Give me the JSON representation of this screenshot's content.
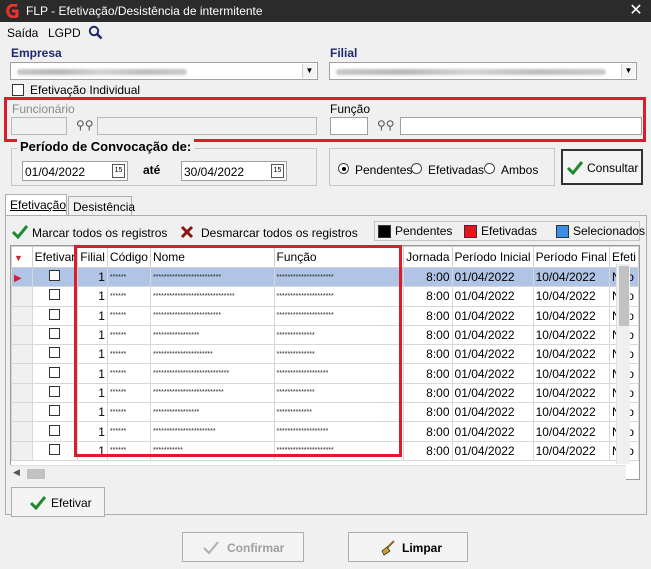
{
  "window": {
    "title": "FLP - Efetivação/Desistência de intermitente",
    "close": "✕"
  },
  "menu": {
    "exit": "Saída",
    "lgpd": "LGPD"
  },
  "empresa": {
    "label": "Empresa"
  },
  "filial": {
    "label": "Filial"
  },
  "individual": {
    "label": "Efetivação Individual"
  },
  "funcionario": {
    "label": "Funcionário"
  },
  "funcao": {
    "label": "Função"
  },
  "period": {
    "label": "Período de Convocação de:",
    "start": "01/04/2022",
    "until": "até",
    "end": "30/04/2022",
    "cal": "15"
  },
  "status": {
    "pending": "Pendentes",
    "effective": "Efetivadas",
    "both": "Ambos"
  },
  "consult": {
    "label": "Consultar"
  },
  "tabs": {
    "efetivacao": "Efetivação",
    "desistencia": "Desistência"
  },
  "actions": {
    "mark_all": "Marcar todos os registros",
    "unmark_all": "Desmarcar todos os registros"
  },
  "legend": [
    {
      "label": "Pendentes",
      "color": "#000000"
    },
    {
      "label": "Efetivadas",
      "color": "#e8141b"
    },
    {
      "label": "Selecionados",
      "color": "#3a8ee6"
    }
  ],
  "grid": {
    "columns": [
      "Efetivar",
      "Filial",
      "Código",
      "Nome",
      "Função",
      "Jornada",
      "Período Inicial",
      "Período Final",
      "Efeti"
    ],
    "rows": [
      {
        "filial": "1",
        "codigo": "******",
        "nome": "*************************",
        "funcao": "*********************",
        "jornada": "8:00",
        "inicio": "01/04/2022",
        "fim": "10/04/2022",
        "efetivado": "Não"
      },
      {
        "filial": "1",
        "codigo": "******",
        "nome": "******************************",
        "funcao": "*********************",
        "jornada": "8:00",
        "inicio": "01/04/2022",
        "fim": "10/04/2022",
        "efetivado": "Não"
      },
      {
        "filial": "1",
        "codigo": "******",
        "nome": "*************************",
        "funcao": "*********************",
        "jornada": "8:00",
        "inicio": "01/04/2022",
        "fim": "10/04/2022",
        "efetivado": "Não"
      },
      {
        "filial": "1",
        "codigo": "******",
        "nome": "*****************",
        "funcao": "**************",
        "jornada": "8:00",
        "inicio": "01/04/2022",
        "fim": "10/04/2022",
        "efetivado": "Não"
      },
      {
        "filial": "1",
        "codigo": "******",
        "nome": "**********************",
        "funcao": "**************",
        "jornada": "8:00",
        "inicio": "01/04/2022",
        "fim": "10/04/2022",
        "efetivado": "Não"
      },
      {
        "filial": "1",
        "codigo": "******",
        "nome": "****************************",
        "funcao": "*******************",
        "jornada": "8:00",
        "inicio": "01/04/2022",
        "fim": "10/04/2022",
        "efetivado": "Não"
      },
      {
        "filial": "1",
        "codigo": "******",
        "nome": "**************************",
        "funcao": "**************",
        "jornada": "8:00",
        "inicio": "01/04/2022",
        "fim": "10/04/2022",
        "efetivado": "Não"
      },
      {
        "filial": "1",
        "codigo": "******",
        "nome": "*****************",
        "funcao": "*************",
        "jornada": "8:00",
        "inicio": "01/04/2022",
        "fim": "10/04/2022",
        "efetivado": "Não"
      },
      {
        "filial": "1",
        "codigo": "******",
        "nome": "***********************",
        "funcao": "*******************",
        "jornada": "8:00",
        "inicio": "01/04/2022",
        "fim": "10/04/2022",
        "efetivado": "Não"
      },
      {
        "filial": "1",
        "codigo": "******",
        "nome": "***********",
        "funcao": "*********************",
        "jornada": "8:00",
        "inicio": "01/04/2022",
        "fim": "10/04/2022",
        "efetivado": "Não"
      }
    ]
  },
  "buttons": {
    "efetivar": "Efetivar",
    "confirmar": "Confirmar",
    "limpar": "Limpar"
  }
}
